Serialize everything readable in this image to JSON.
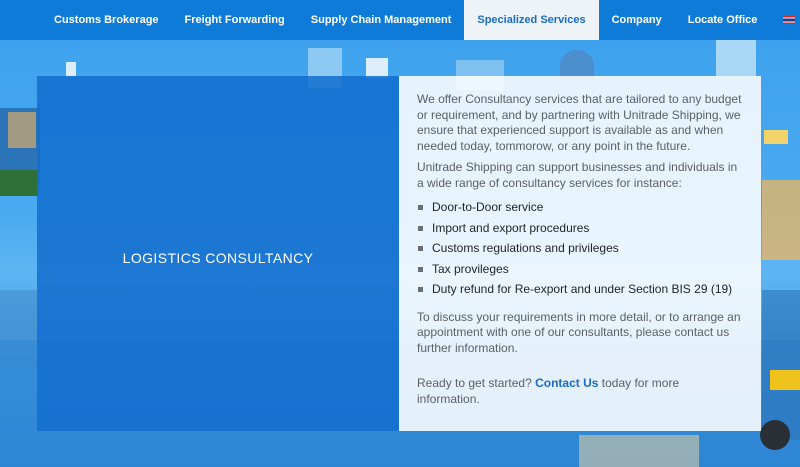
{
  "nav": {
    "items": [
      {
        "label": "Customs Brokerage",
        "active": false
      },
      {
        "label": "Freight Forwarding",
        "active": false
      },
      {
        "label": "Supply Chain Management",
        "active": false
      },
      {
        "label": "Specialized Services",
        "active": true
      },
      {
        "label": "Company",
        "active": false
      },
      {
        "label": "Locate Office",
        "active": false
      }
    ],
    "language_label": "TH",
    "language_icon": "thailand-flag-icon"
  },
  "hero": {
    "title": "LOGISTICS CONSULTANCY"
  },
  "content": {
    "intro": "We offer Consultancy services that are tailored to any budget or requirement, and by partnering with Unitrade Shipping, we ensure that experienced support is available as and when needed today, tommorow, or any point in the future.",
    "lead": "Unitrade Shipping can support businesses and individuals in a wide range of consultancy services for instance:",
    "services": [
      "Door-to-Door service",
      "Import and export procedures",
      "Customs regulations and privileges",
      "Tax provileges",
      "Duty refund for Re-export and under Section BIS 29 (19)"
    ],
    "discuss": "To discuss your requirements in more detail, or to arrange an appointment with one of our consultants, please contact us further information.",
    "cta_prefix": "Ready to get started? ",
    "cta_link": "Contact Us",
    "cta_suffix": " today for more information."
  },
  "colors": {
    "nav_bg": "#0f7bd8",
    "nav_active_bg": "#eef3f8",
    "accent": "#1a6cc4",
    "hero_card": "#136ece"
  }
}
